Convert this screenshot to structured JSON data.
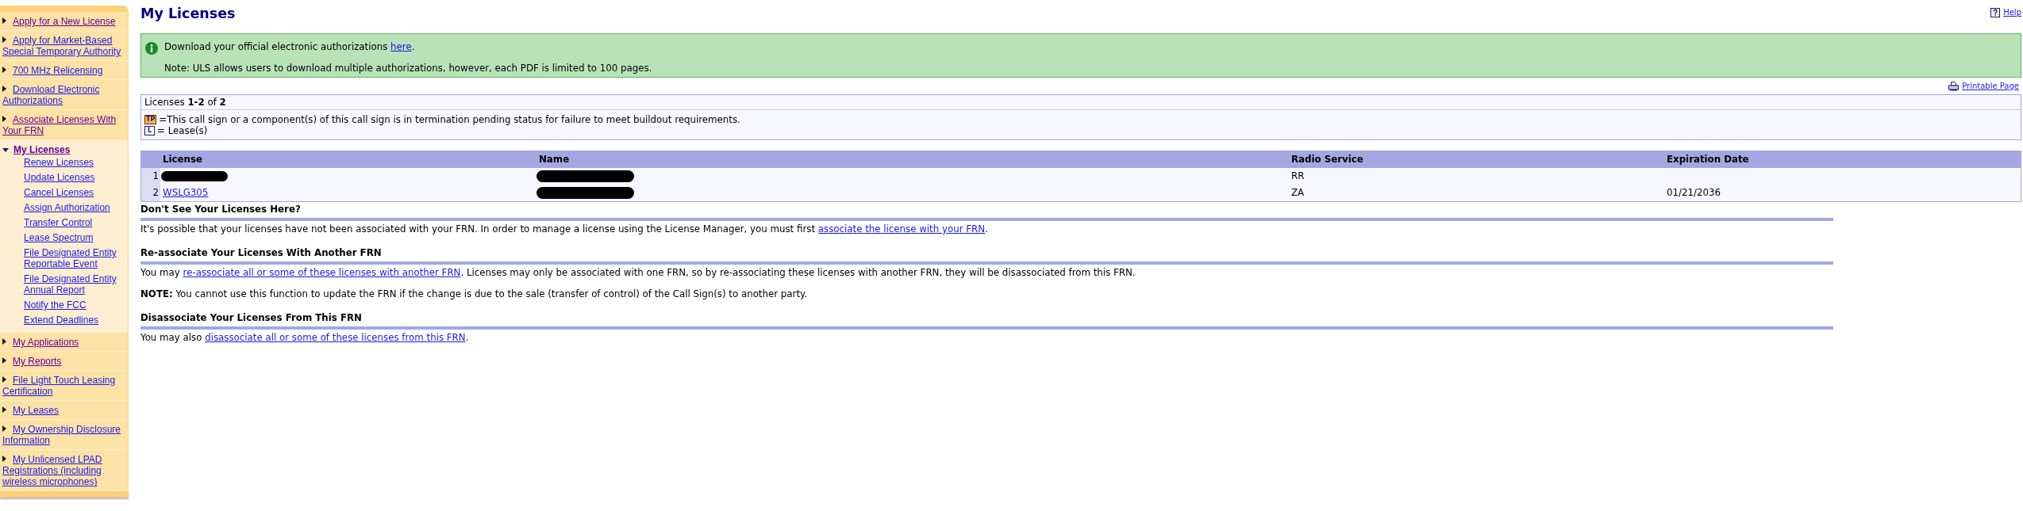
{
  "sidebar": {
    "items": [
      {
        "label": "Apply for a New License",
        "visited": true,
        "selected": false,
        "expanded": false
      },
      {
        "label": "Apply for Market-Based Special Temporary Authority",
        "visited": false,
        "selected": false,
        "expanded": false
      },
      {
        "label": "700 MHz Relicensing",
        "visited": false,
        "selected": false,
        "expanded": false
      },
      {
        "label": "Download Electronic Authorizations",
        "visited": false,
        "selected": false,
        "expanded": false
      },
      {
        "label": "Associate Licenses With Your FRN",
        "visited": true,
        "selected": false,
        "expanded": false
      },
      {
        "label": "My Licenses",
        "visited": true,
        "selected": true,
        "expanded": true,
        "children": [
          {
            "label": "Renew Licenses"
          },
          {
            "label": "Update Licenses"
          },
          {
            "label": "Cancel Licenses"
          },
          {
            "label": "Assign Authorization"
          },
          {
            "label": "Transfer Control"
          },
          {
            "label": "Lease Spectrum"
          },
          {
            "label": "File Designated Entity Reportable Event"
          },
          {
            "label": "File Designated Entity Annual Report"
          },
          {
            "label": "Notify the FCC"
          },
          {
            "label": "Extend Deadlines"
          }
        ]
      },
      {
        "label": "My Applications",
        "visited": true,
        "selected": false,
        "expanded": false
      },
      {
        "label": "My Reports",
        "visited": true,
        "selected": false,
        "expanded": false
      },
      {
        "label": "File Light Touch Leasing Certification",
        "visited": false,
        "selected": false,
        "expanded": false
      },
      {
        "label": "My Leases",
        "visited": false,
        "selected": false,
        "expanded": false
      },
      {
        "label": "My Ownership Disclosure Information",
        "visited": false,
        "selected": false,
        "expanded": false
      },
      {
        "label": "My Unlicensed LPAD Registrations (including wireless microphones)",
        "visited": false,
        "selected": false,
        "expanded": false
      }
    ]
  },
  "page": {
    "title": "My Licenses",
    "help_link": "Help"
  },
  "notice": {
    "before": "Download your official electronic authorizations ",
    "link": "here",
    "after": ".",
    "note": "Note: ULS allows users to download multiple authorizations, however, each PDF is limited to 100 pages."
  },
  "printable_link": "Printable Page",
  "licenses_summary": {
    "count": "Licenses **1-2** of **2**",
    "legend": [
      {
        "kind": "termination",
        "badge": "TP",
        "text": "=This call sign or a component(s) of this call sign is in termination pending status for failure to meet buildout requirements."
      },
      {
        "kind": "lease",
        "badge": "L",
        "text": "= Lease(s)"
      }
    ]
  },
  "table": {
    "columns": [
      "License",
      "Name",
      "Radio Service",
      "Expiration Date"
    ],
    "rows": [
      {
        "number": "1",
        "license": {
          "redacted": true
        },
        "name": {
          "redacted": true
        },
        "radio_service": "RR"
      },
      {
        "number": "2",
        "license": {
          "text": "WSLG305",
          "redacted": false
        },
        "name": {
          "redacted": true
        },
        "radio_service": "ZA",
        "expiration_date": "01/21/2036"
      }
    ]
  },
  "sections": [
    {
      "heading": "Don't See Your Licenses Here?",
      "paragraphs": [
        {
          "kind": "link_sentence",
          "before": "It's possible that your licenses have not been associated with your FRN. In order to manage a license using the License Manager, you must first ",
          "link": "associate the license with your FRN",
          "after": "."
        }
      ]
    },
    {
      "heading": "Re-associate Your Licenses With Another FRN",
      "paragraphs": [
        {
          "kind": "link_sentence",
          "before": "You may ",
          "link": "re-associate all or some of these licenses with another FRN",
          "after": ". Licenses may only be associated with one FRN, so by re-associating these licenses with another FRN, they will be disassociated from this FRN."
        },
        {
          "kind": "note",
          "text": "**NOTE:** You cannot use this function to update the FRN if the change is due to the sale (transfer of control) of the Call Sign(s) to another party."
        }
      ]
    },
    {
      "heading": "Disassociate Your Licenses From This FRN",
      "paragraphs": [
        {
          "kind": "link_sentence",
          "before": "You may also ",
          "link": "disassociate all or some of these licenses from this FRN",
          "after": "."
        }
      ]
    }
  ]
}
